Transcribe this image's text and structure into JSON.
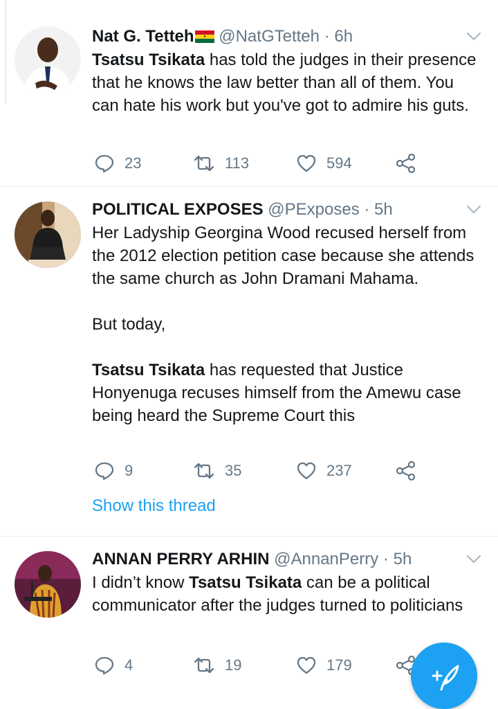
{
  "colors": {
    "accent": "#1da1f2",
    "muted": "#657786",
    "divider": "#e6ecf0"
  },
  "tweets": [
    {
      "name": "Nat G. Tetteh",
      "flag": "ghana-flag-emoji",
      "handle": "@NatGTetteh",
      "separator": "·",
      "time": "6h",
      "text_parts": [
        {
          "bold": "Tsatsu Tsikata",
          "rest": " has told the judges in their presence that he knows the law better than all of them. You can hate his work but you've got to admire his guts."
        }
      ],
      "replies": "23",
      "retweets": "113",
      "likes": "594"
    },
    {
      "name": "POLITICAL EXPOSES",
      "handle": "@PExposes",
      "separator": "·",
      "time": "5h",
      "para1": "Her Ladyship Georgina Wood recused herself from the 2012 election petition case because she attends the same church as John Dramani Mahama.",
      "para2": "But today,",
      "para3_bold": "Tsatsu Tsikata",
      "para3_rest": " has requested that Justice Honyenuga recuses himself from the Amewu case being heard the Supreme Court this",
      "replies": "9",
      "retweets": "35",
      "likes": "237",
      "show_thread": "Show this thread"
    },
    {
      "name": "ANNAN PERRY ARHIN",
      "handle": "@AnnanPerry",
      "separator": "·",
      "time": "5h",
      "text_pre": "I didn’t know ",
      "text_bold": "Tsatsu Tsikata",
      "text_rest": " can be a political communicator after the judges turned to politicians",
      "replies": "4",
      "retweets": "19",
      "likes": "179"
    }
  ],
  "icons": {
    "reply": "reply-icon",
    "retweet": "retweet-icon",
    "like": "heart-icon",
    "share": "share-icon",
    "caret": "chevron-down-icon",
    "compose": "compose-tweet-icon"
  }
}
